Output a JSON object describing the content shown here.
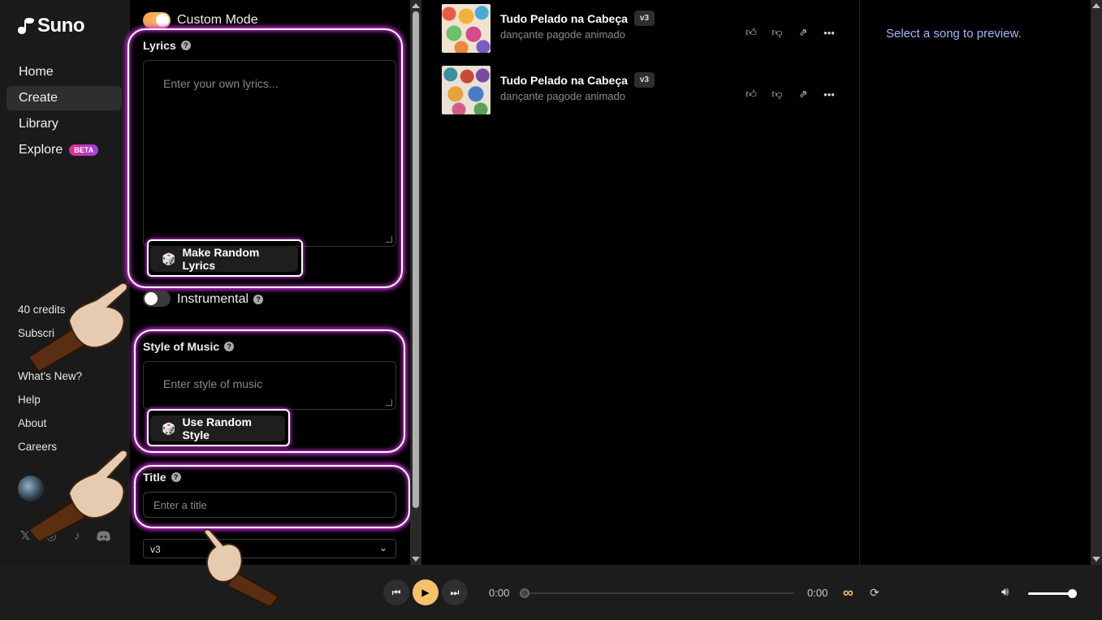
{
  "app": {
    "logo_text": "Suno"
  },
  "nav": {
    "items": [
      {
        "label": "Home"
      },
      {
        "label": "Create"
      },
      {
        "label": "Library"
      },
      {
        "label": "Explore",
        "badge": "BETA"
      }
    ]
  },
  "sidebar": {
    "credits": "40 credits",
    "subscribe": "Subscri",
    "links": [
      "What's New?",
      "Help",
      "About",
      "Careers"
    ],
    "socials": [
      "x-icon",
      "instagram-icon",
      "tiktok-icon",
      "discord-icon"
    ]
  },
  "create": {
    "custom_mode_label": "Custom Mode",
    "custom_mode_on": true,
    "lyrics_label": "Lyrics",
    "lyrics_placeholder": "Enter your own lyrics...",
    "random_lyrics_button": "Make Random Lyrics",
    "instrumental_label": "Instrumental",
    "instrumental_on": false,
    "style_label": "Style of Music",
    "style_placeholder": "Enter style of music",
    "random_style_button": "Use Random Style",
    "title_label": "Title",
    "title_placeholder": "Enter a title",
    "model_selected": "v3"
  },
  "songs": [
    {
      "title": "Tudo Pelado na Cabeça",
      "version": "v3",
      "style": "dançante pagode animado"
    },
    {
      "title": "Tudo Pelado na Cabeça",
      "version": "v3",
      "style": "dançante pagode animado"
    }
  ],
  "preview": {
    "empty_text": "Select a song to preview."
  },
  "player": {
    "current_time": "0:00",
    "duration": "0:00",
    "progress": 0,
    "volume": 1.0
  },
  "colors": {
    "accent": "#f5c26b",
    "highlight_glow": "#d02ee0",
    "beta_gradient_start": "#e0318a",
    "beta_gradient_end": "#a040e8",
    "preview_text": "#a9b7ff"
  }
}
